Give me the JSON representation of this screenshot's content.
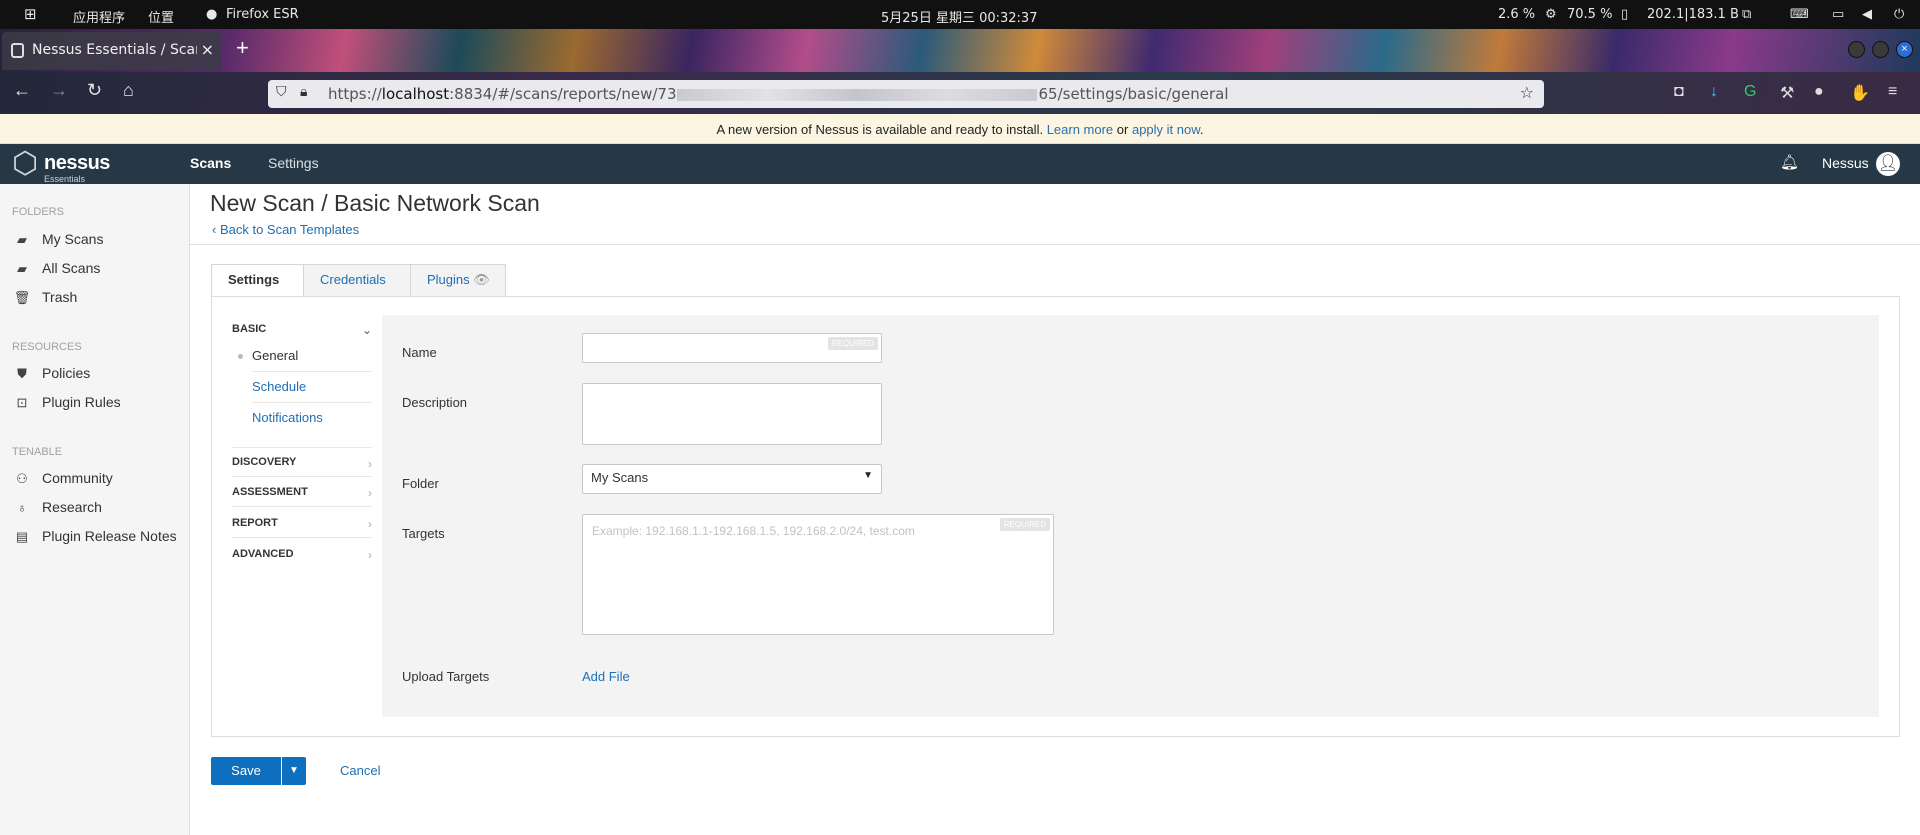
{
  "system": {
    "apps_label": "应用程序",
    "places_label": "位置",
    "browser_name": "Firefox ESR",
    "clock": "5月25日 星期三 00:32:37",
    "cpu": "2.6 %",
    "mem": "70.5 %",
    "net": "202.1|183.1 B"
  },
  "browser": {
    "tab_title": "Nessus Essentials / Scans",
    "url_prefix": "https://",
    "url_host": "localhost",
    "url_path_start": ":8834/#/scans/reports/new/73",
    "url_path_end": "65/settings/basic/general"
  },
  "notice": {
    "text_before": "A new version of Nessus is available and ready to install. ",
    "learn_more": "Learn more",
    "or": " or ",
    "apply": "apply it now",
    "end": "."
  },
  "header": {
    "logo_name": "nessus",
    "logo_sub": "Essentials",
    "nav": [
      "Scans",
      "Settings"
    ],
    "user": "Nessus"
  },
  "sidebar": {
    "folders_heading": "FOLDERS",
    "folders": [
      "My Scans",
      "All Scans",
      "Trash"
    ],
    "resources_heading": "RESOURCES",
    "resources": [
      "Policies",
      "Plugin Rules"
    ],
    "tenable_heading": "TENABLE",
    "tenable": [
      "Community",
      "Research",
      "Plugin Release Notes"
    ]
  },
  "page": {
    "title": "New Scan / Basic Network Scan",
    "back_link": "‹ Back to Scan Templates",
    "tabs": [
      "Settings",
      "Credentials",
      "Plugins"
    ]
  },
  "settings_nav": {
    "basic": "BASIC",
    "basic_items": [
      "General",
      "Schedule",
      "Notifications"
    ],
    "sections": [
      "DISCOVERY",
      "ASSESSMENT",
      "REPORT",
      "ADVANCED"
    ]
  },
  "form": {
    "name_label": "Name",
    "name_value": "",
    "required_tag": "REQUIRED",
    "description_label": "Description",
    "folder_label": "Folder",
    "folder_value": "My Scans",
    "targets_label": "Targets",
    "targets_placeholder": "Example: 192.168.1.1-192.168.1.5, 192.168.2.0/24, test.com",
    "upload_label": "Upload Targets",
    "add_file": "Add File"
  },
  "actions": {
    "save": "Save",
    "cancel": "Cancel"
  }
}
